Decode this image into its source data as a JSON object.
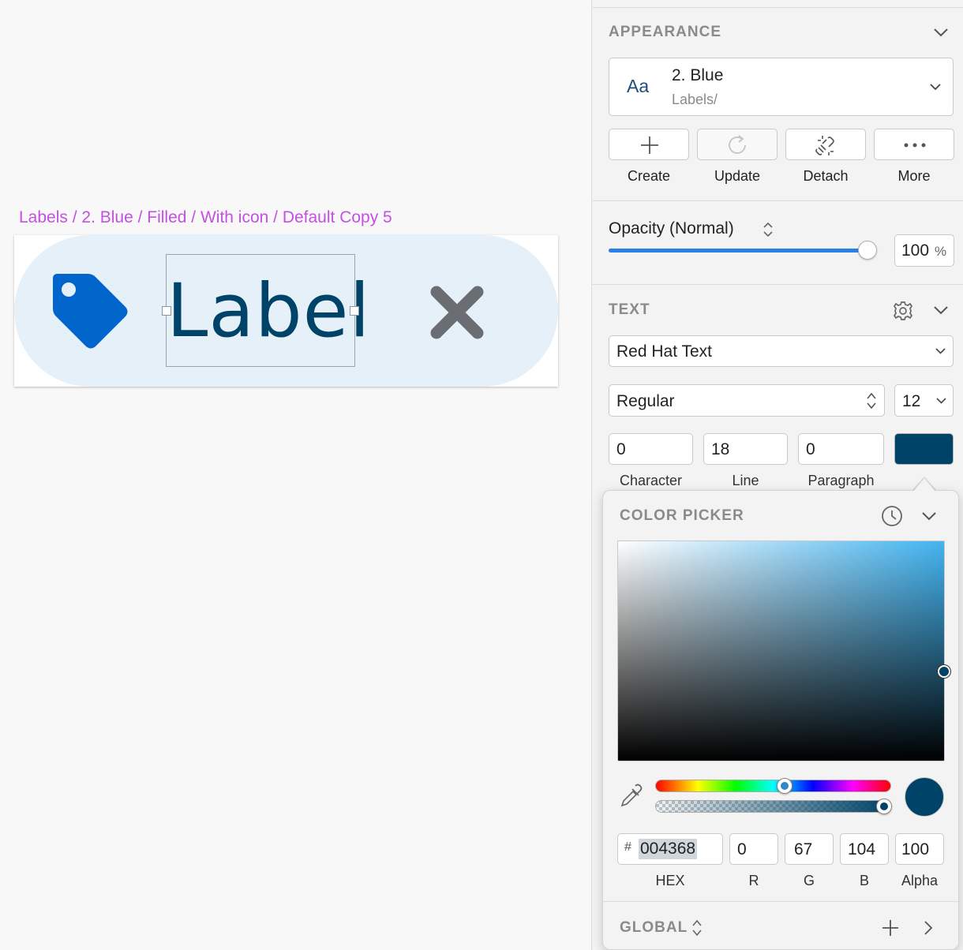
{
  "canvas": {
    "artboard_title": "Labels / 2. Blue / Filled / With icon / Default Copy 5",
    "label_text": "Label",
    "icons": {
      "tag": "tag-icon",
      "close": "close-icon"
    }
  },
  "appearance": {
    "title": "APPEARANCE",
    "style_preview": "Aa",
    "style_name": "2. Blue",
    "style_path": "Labels/",
    "actions": [
      {
        "label": "Create",
        "icon": "plus-icon"
      },
      {
        "label": "Update",
        "icon": "refresh-icon"
      },
      {
        "label": "Detach",
        "icon": "detach-link-icon"
      },
      {
        "label": "More",
        "icon": "ellipsis-icon"
      }
    ],
    "opacity_label": "Opacity (Normal)",
    "opacity_value": "100",
    "opacity_unit": "%",
    "opacity_fraction": 1.0
  },
  "text": {
    "title": "TEXT",
    "font_family": "Red Hat Text",
    "font_weight": "Regular",
    "font_size": "12",
    "character": "0",
    "line": "18",
    "paragraph": "0",
    "character_label": "Character",
    "line_label": "Line",
    "paragraph_label": "Paragraph",
    "color": "#004368"
  },
  "color_picker": {
    "title": "COLOR PICKER",
    "hex_prefix": "#",
    "hex": "004368",
    "r": "0",
    "g": "67",
    "b": "104",
    "alpha": "100",
    "hex_label": "HEX",
    "r_label": "R",
    "g_label": "G",
    "b_label": "B",
    "alpha_label": "Alpha",
    "global_label": "GLOBAL",
    "hue_fraction": 0.55,
    "alpha_fraction": 1.0
  },
  "colors": {
    "accent": "#2a7fe6",
    "label_fill": "#e6f0f8",
    "tag_icon": "#0066cc",
    "close_icon": "#6a6e73",
    "artboard_title": "#c550e0"
  }
}
